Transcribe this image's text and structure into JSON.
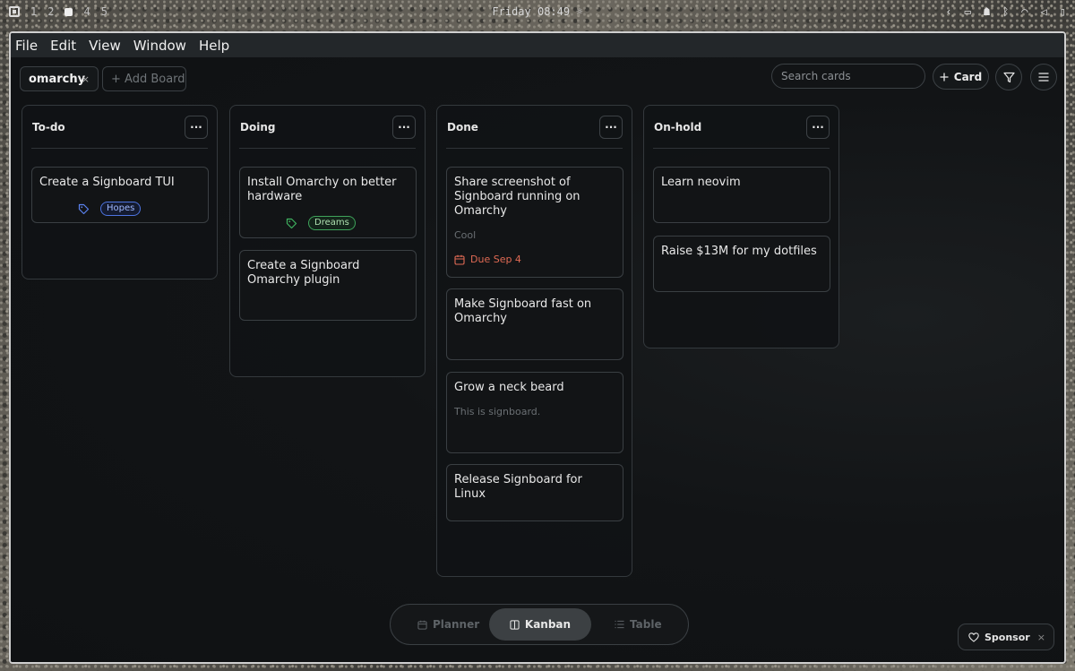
{
  "system": {
    "workspaces": [
      "1",
      "2",
      "4",
      "5"
    ],
    "clock": "Friday 08:49",
    "clock_icon": "sun-icon"
  },
  "menu": [
    "File",
    "Edit",
    "View",
    "Window",
    "Help"
  ],
  "tabs": {
    "active": "omarchy",
    "close": "×",
    "add": "+ Add Board"
  },
  "toolbar": {
    "search_placeholder": "Search cards",
    "card_button": "Card"
  },
  "columns": [
    {
      "title": "To-do",
      "cards": [
        {
          "title": "Create a Signboard TUI",
          "tag": "Hopes"
        }
      ]
    },
    {
      "title": "Doing",
      "cards": [
        {
          "title": "Install Omarchy on better hardware",
          "tag": "Dreams"
        },
        {
          "title": "Create a Signboard Omarchy plugin"
        }
      ]
    },
    {
      "title": "Done",
      "cards": [
        {
          "title": "Share screenshot of Signboard running on Omarchy",
          "desc": "Cool",
          "due": "Due Sep 4"
        },
        {
          "title": "Make Signboard fast on Omarchy"
        },
        {
          "title": "Grow a neck beard",
          "desc": "This is signboard."
        },
        {
          "title": "Release Signboard for Linux"
        }
      ]
    },
    {
      "title": "On-hold",
      "cards": [
        {
          "title": "Learn neovim"
        },
        {
          "title": "Raise $13M for my dotfiles"
        }
      ]
    }
  ],
  "views": {
    "planner": "Planner",
    "kanban": "Kanban",
    "table": "Table"
  },
  "sponsor": {
    "label": "Sponsor",
    "close": "×"
  },
  "colors": {
    "accent_due": "#e06a54",
    "tag_hopes": "#4d74e0",
    "tag_dreams": "#3ea35a"
  }
}
